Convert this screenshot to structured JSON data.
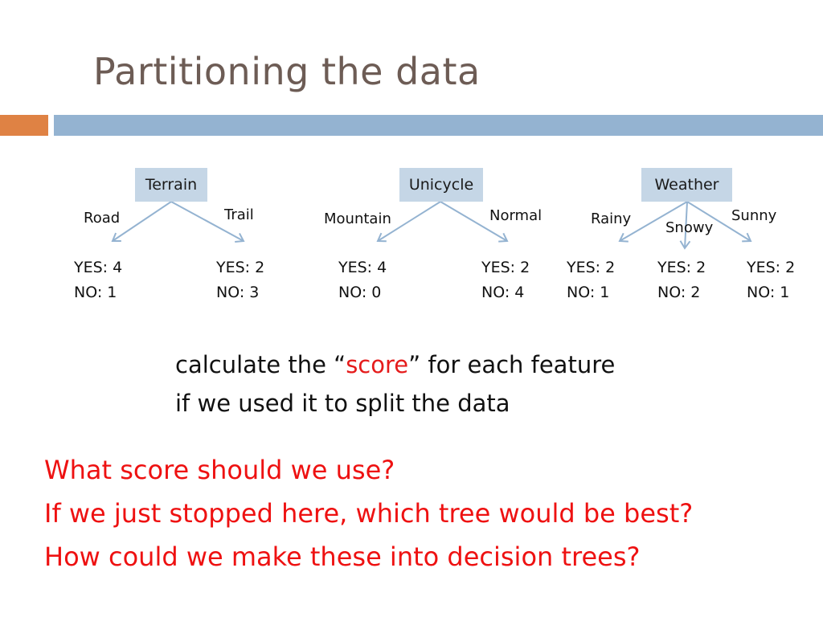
{
  "slide": {
    "title": "Partitioning the data",
    "accent_colors": {
      "orange": "#df8244",
      "blue": "#94b3d1",
      "node_fill": "#c5d6e6",
      "highlight_red": "#ee1111"
    }
  },
  "trees": [
    {
      "feature": "Terrain",
      "branches": [
        {
          "label": "Road",
          "yes": "YES: 4",
          "no": "NO: 1"
        },
        {
          "label": "Trail",
          "yes": "YES: 2",
          "no": "NO: 3"
        }
      ]
    },
    {
      "feature": "Unicycle",
      "branches": [
        {
          "label": "Mountain",
          "yes": "YES: 4",
          "no": "NO: 0"
        },
        {
          "label": "Normal",
          "yes": "YES: 2",
          "no": "NO: 4"
        }
      ]
    },
    {
      "feature": "Weather",
      "branches": [
        {
          "label": "Rainy",
          "yes": "YES: 2",
          "no": "NO: 1"
        },
        {
          "label": "Snowy",
          "yes": "YES: 2",
          "no": "NO: 2"
        },
        {
          "label": "Sunny",
          "yes": "YES: 2",
          "no": "NO: 1"
        }
      ]
    }
  ],
  "instruction": {
    "before": "calculate the “",
    "highlight": "score",
    "after": "” for each feature",
    "line2": "if we used it to split the data"
  },
  "questions": [
    "What score should we use?",
    "If we just stopped here, which tree would be best?",
    "How could we make these into decision trees?"
  ]
}
